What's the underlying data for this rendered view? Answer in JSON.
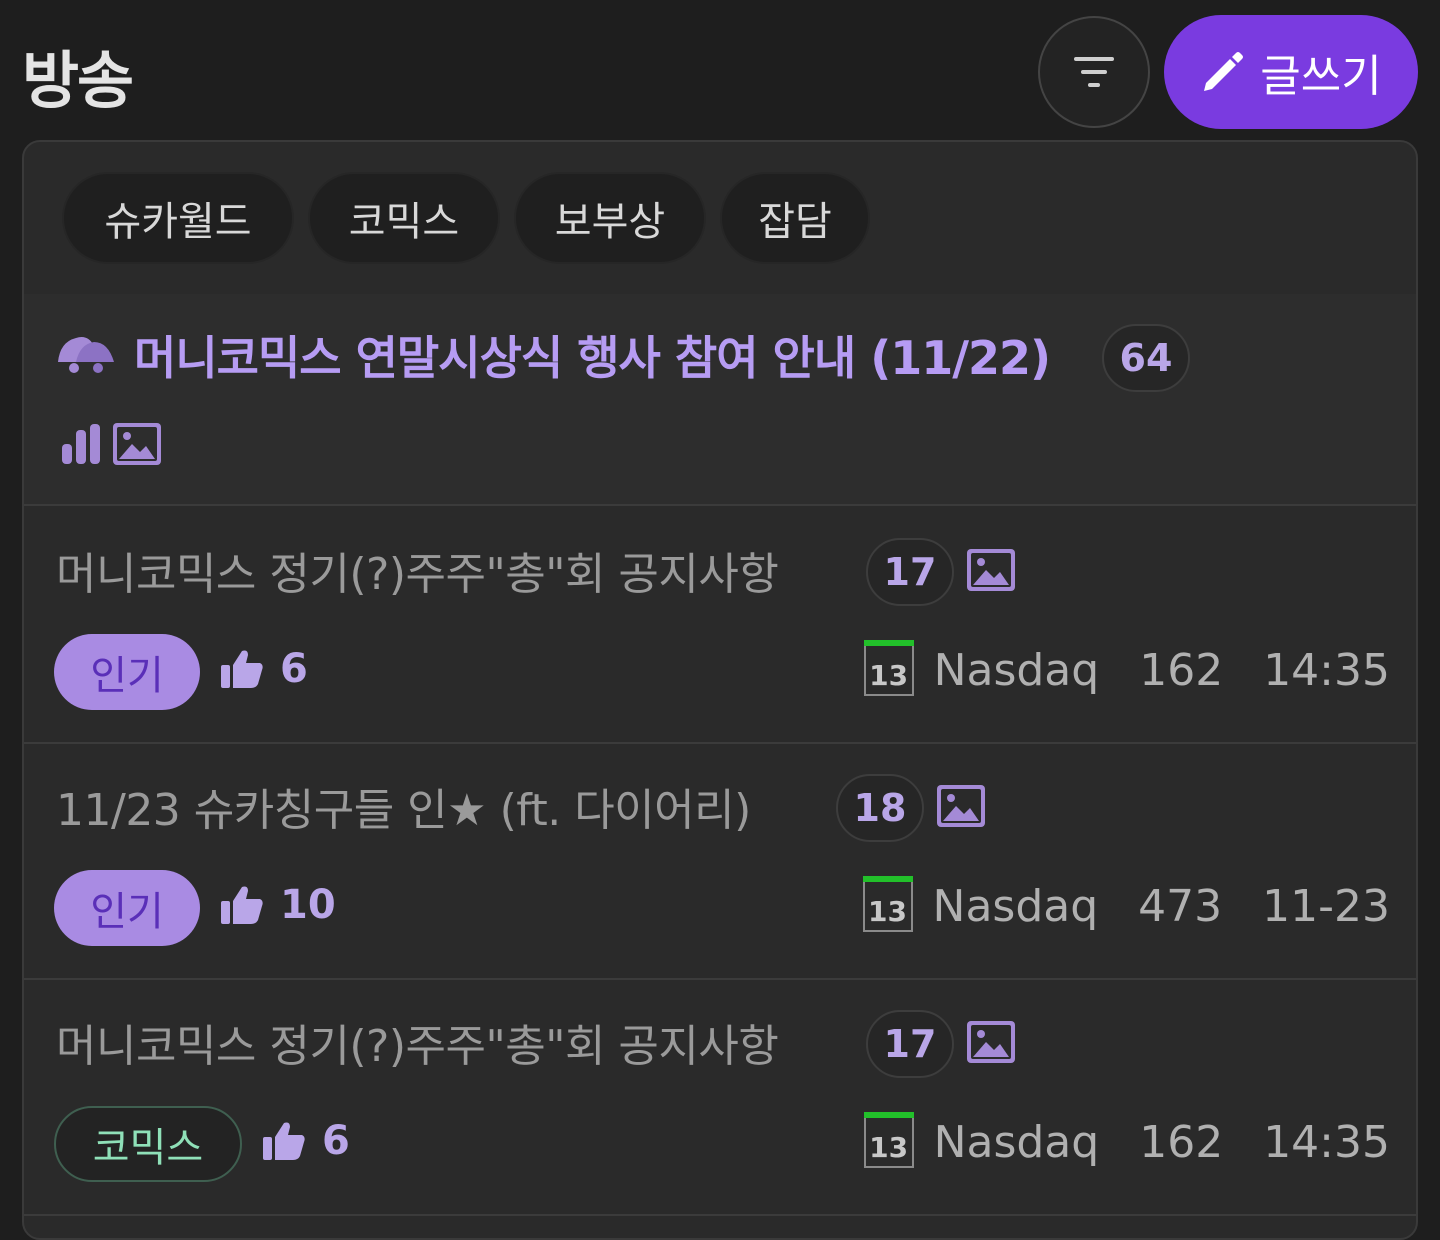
{
  "header": {
    "title": "방송",
    "filter_icon": "filter-icon",
    "write_label": "글쓰기",
    "write_icon": "pencil-icon",
    "accent": "#7a3be0"
  },
  "categories": [
    {
      "label": "슈카월드"
    },
    {
      "label": "코믹스"
    },
    {
      "label": "보부상"
    },
    {
      "label": "잡담"
    }
  ],
  "notice": {
    "icon": "megaphone-icon",
    "title": "머니코믹스 연말시상식 행사 참여 안내 (11/22)",
    "comment_count": "64",
    "icons": [
      "poll-icon",
      "image-icon"
    ],
    "color": "#b69cf3"
  },
  "posts": [
    {
      "title": "머니코믹스 정기(?)주주\"총\"회 공지사항",
      "comment_count": "17",
      "has_image": true,
      "tag": "인기",
      "likes": "6",
      "level": "13",
      "author": "Nasdaq",
      "views": "162",
      "time": "14:35"
    },
    {
      "title": "11/23 슈카칭구들 인★ (ft. 다이어리)",
      "comment_count": "18",
      "has_image": true,
      "tag": "인기",
      "likes": "10",
      "level": "13",
      "author": "Nasdaq",
      "views": "473",
      "time": "11-23"
    },
    {
      "title": "머니코믹스 정기(?)주주\"총\"회 공지사항",
      "comment_count": "17",
      "has_image": true,
      "tag": "코믹스",
      "likes": "6",
      "level": "13",
      "author": "Nasdaq",
      "views": "162",
      "time": "14:35"
    }
  ]
}
